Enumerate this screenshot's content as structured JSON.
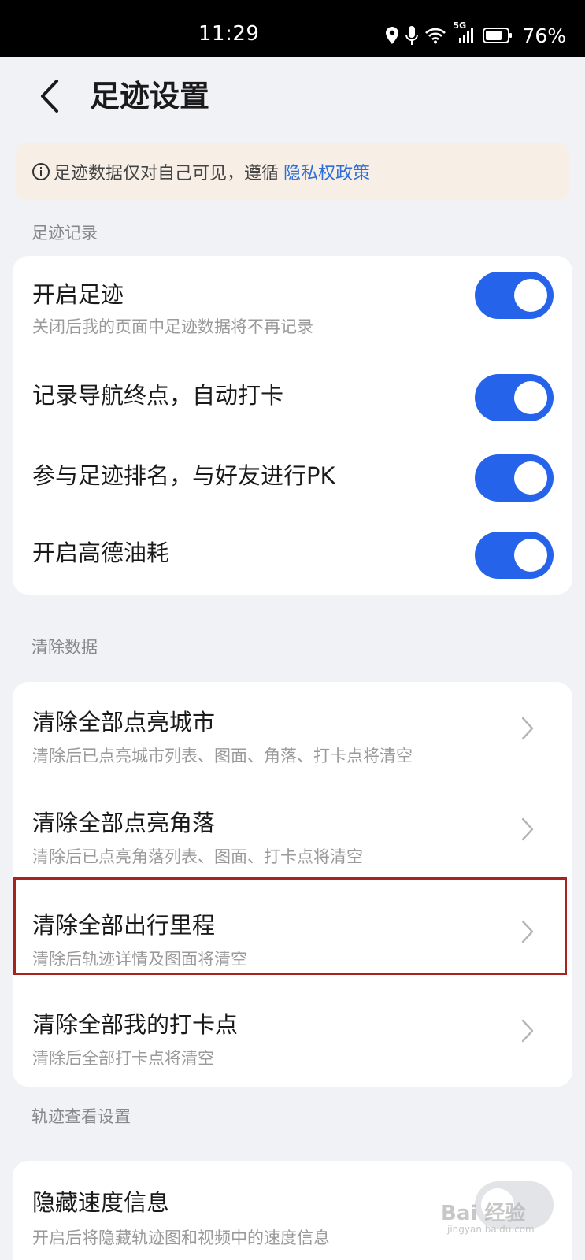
{
  "status_bar": {
    "time": "11:29",
    "network": "5G",
    "battery": "76%",
    "icons": [
      "location-icon",
      "microphone-icon",
      "wifi-icon",
      "signal-icon",
      "battery-icon"
    ]
  },
  "header": {
    "title": "足迹设置",
    "back_icon": "back-chevron-icon"
  },
  "notice": {
    "text": "足迹数据仅对自己可见，遵循",
    "link": "隐私权政策",
    "background": "#f7efe6",
    "link_color": "#2f6ed8"
  },
  "sections": {
    "record": {
      "label": "足迹记录",
      "items": [
        {
          "title": "开启足迹",
          "subtitle": "关闭后我的页面中足迹数据将不再记录",
          "on": true
        },
        {
          "title": "记录导航终点，自动打卡",
          "on": true
        },
        {
          "title": "参与足迹排名，与好友进行PK",
          "on": true
        },
        {
          "title": "开启高德油耗",
          "on": true
        }
      ]
    },
    "clear": {
      "label": "清除数据",
      "items": [
        {
          "title": "清除全部点亮城市",
          "subtitle": "清除后已点亮城市列表、图面、角落、打卡点将清空"
        },
        {
          "title": "清除全部点亮角落",
          "subtitle": "清除后已点亮角落列表、图面、打卡点将清空"
        },
        {
          "title": "清除全部出行里程",
          "subtitle": "清除后轨迹详情及图面将清空",
          "highlighted": true
        },
        {
          "title": "清除全部我的打卡点",
          "subtitle": "清除后全部打卡点将清空"
        }
      ]
    },
    "track_view": {
      "label": "轨迹查看设置",
      "items": [
        {
          "title": "隐藏速度信息",
          "subtitle": "开启后将隐藏轨迹图和视频中的速度信息",
          "on": false
        }
      ]
    }
  },
  "colors": {
    "accent": "#2563eb",
    "background": "#f1f2f6",
    "highlight_border": "#a8231f"
  },
  "watermark": {
    "text": "Bai 经验",
    "sub": "jingyan.baidu.com"
  }
}
